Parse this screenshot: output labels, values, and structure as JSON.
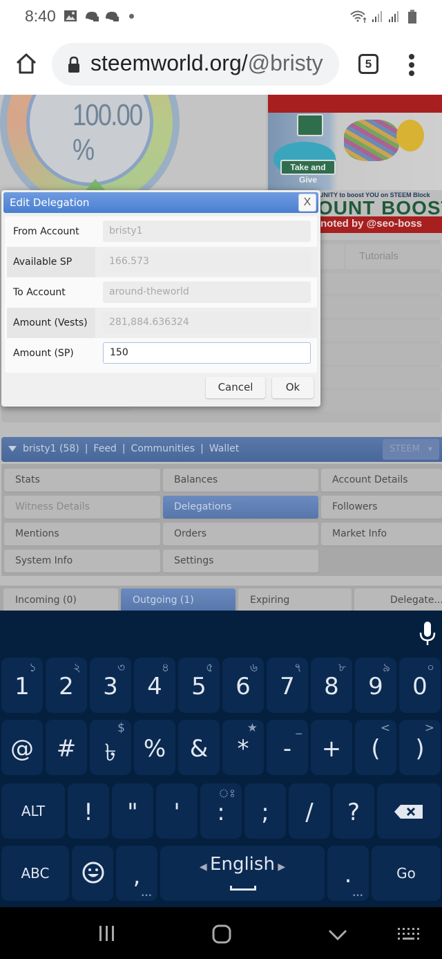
{
  "status_bar": {
    "time": "8:40",
    "left_icons": [
      "image-icon",
      "game-controller-icon",
      "game-controller-icon",
      "dot-icon"
    ],
    "right_icons": [
      "wifi-icon",
      "signal-icon",
      "signal-icon",
      "battery-icon"
    ]
  },
  "browser": {
    "url_domain": "steemworld.org/",
    "url_path": "@bristy",
    "tab_count": "5"
  },
  "background": {
    "gauge_value": "100.00 %",
    "banner": {
      "sign_text": "Take and Give",
      "line1": "UNITY to boost YOU on STEEM Block",
      "line2": "OUNT BOOST",
      "line3": "noted by @seo-boss"
    },
    "tabs": [
      {
        "label": ""
      },
      {
        "label": "Tutorials"
      }
    ]
  },
  "account_nav": {
    "user": "bristy1 (58)",
    "links": [
      "Feed",
      "Communities",
      "Wallet"
    ],
    "separator": "|",
    "currency": "STEEM",
    "menu": [
      {
        "label": "Stats",
        "state": "normal"
      },
      {
        "label": "Balances",
        "state": "normal"
      },
      {
        "label": "Account Details",
        "state": "normal"
      },
      {
        "label": "Witness Details",
        "state": "disabled"
      },
      {
        "label": "Delegations",
        "state": "active"
      },
      {
        "label": "Followers",
        "state": "normal"
      },
      {
        "label": "Mentions",
        "state": "normal"
      },
      {
        "label": "Orders",
        "state": "normal"
      },
      {
        "label": "Market Info",
        "state": "normal"
      },
      {
        "label": "System Info",
        "state": "normal"
      },
      {
        "label": "Settings",
        "state": "normal"
      }
    ],
    "sub_tabs": [
      {
        "label": "Incoming (0)",
        "active": false
      },
      {
        "label": "Outgoing (1)",
        "active": true
      },
      {
        "label": "Expiring",
        "active": false
      },
      {
        "label": "Delegate...",
        "active": false
      }
    ]
  },
  "dialog": {
    "title": "Edit Delegation",
    "close_label": "X",
    "fields": [
      {
        "label": "From Account",
        "value": "bristy1",
        "editable": false
      },
      {
        "label": "Available SP",
        "value": "166.573",
        "editable": false
      },
      {
        "label": "To Account",
        "value": "around-theworld",
        "editable": false
      },
      {
        "label": "Amount (Vests)",
        "value": "281,884.636324",
        "editable": false
      },
      {
        "label": "Amount (SP)",
        "value": "150",
        "editable": true
      }
    ],
    "cancel_label": "Cancel",
    "ok_label": "Ok"
  },
  "keyboard": {
    "row1": [
      {
        "main": "1",
        "sub": "১"
      },
      {
        "main": "2",
        "sub": "২"
      },
      {
        "main": "3",
        "sub": "৩"
      },
      {
        "main": "4",
        "sub": "৪"
      },
      {
        "main": "5",
        "sub": "৫"
      },
      {
        "main": "6",
        "sub": "৬"
      },
      {
        "main": "7",
        "sub": "৭"
      },
      {
        "main": "8",
        "sub": "৮"
      },
      {
        "main": "9",
        "sub": "৯"
      },
      {
        "main": "0",
        "sub": "০"
      }
    ],
    "row2": [
      {
        "main": "@",
        "sub": ""
      },
      {
        "main": "#",
        "sub": ""
      },
      {
        "main": "৳",
        "sub": "$"
      },
      {
        "main": "%",
        "sub": ""
      },
      {
        "main": "&",
        "sub": ""
      },
      {
        "main": "*",
        "sub": "★"
      },
      {
        "main": "-",
        "sub": "_"
      },
      {
        "main": "+",
        "sub": ""
      },
      {
        "main": "(",
        "sub": "<"
      },
      {
        "main": ")",
        "sub": ">"
      }
    ],
    "row3": [
      {
        "main": "ALT",
        "sub": ""
      },
      {
        "main": "!",
        "sub": ""
      },
      {
        "main": "\"",
        "sub": ""
      },
      {
        "main": "'",
        "sub": ""
      },
      {
        "main": ":",
        "sub": "ঃ"
      },
      {
        "main": ";",
        "sub": ""
      },
      {
        "main": "/",
        "sub": ""
      },
      {
        "main": "?",
        "sub": ""
      }
    ],
    "abc_label": "ABC",
    "comma": ",",
    "space_language": "English",
    "period": ".",
    "go_label": "Go"
  },
  "nav_bar": {
    "buttons": [
      "recents-icon",
      "home-icon",
      "back-icon",
      "keyboard-switch-icon"
    ]
  }
}
